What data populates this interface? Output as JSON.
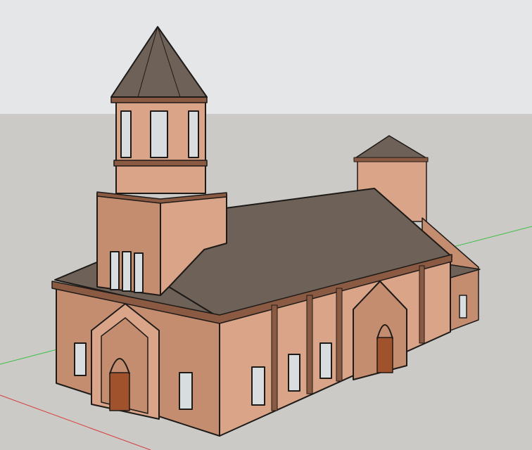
{
  "viewport": {
    "sky_color": "#e4e6e7",
    "ground_color": "#cbcac6"
  },
  "axes": {
    "red_axis_color": "#d83a3a",
    "green_axis_color": "#3cbf46"
  },
  "model": {
    "brick_color": "#d9a487",
    "brick_shade_color": "#c58d70",
    "roof_color": "#6d6158",
    "trim_color": "#8a5a42",
    "door_color": "#a0522d",
    "window_glass_color": "#d8dde0",
    "outline_color": "#1e1a18"
  }
}
